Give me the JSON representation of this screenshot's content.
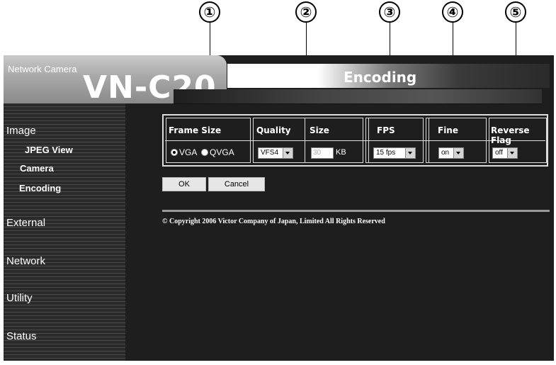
{
  "callouts": [
    "①",
    "②",
    "③",
    "④",
    "⑤"
  ],
  "header": {
    "product_line": "Network Camera",
    "model_prefix": "VN-",
    "model_suffix": "C20",
    "page_title": "Encoding"
  },
  "sidebar": {
    "sections": [
      {
        "label": "Image"
      },
      {
        "label": "External"
      },
      {
        "label": "Network"
      },
      {
        "label": "Utility"
      },
      {
        "label": "Status"
      }
    ],
    "image_items": [
      {
        "label": "JPEG View"
      },
      {
        "label": "Camera"
      },
      {
        "label": "Encoding"
      }
    ]
  },
  "settings": {
    "frame_size": {
      "header": "Frame Size",
      "options": [
        "VGA",
        "QVGA"
      ],
      "selected": "VGA"
    },
    "quality": {
      "header": "Quality",
      "value": "VFS4"
    },
    "size": {
      "header": "Size",
      "value": "30",
      "unit": "KB"
    },
    "fps": {
      "header": "FPS",
      "value": "15 fps"
    },
    "fine": {
      "header": "Fine",
      "value": "on"
    },
    "reverse_flag": {
      "header": "Reverse Flag",
      "value": "off"
    }
  },
  "buttons": {
    "ok": "OK",
    "cancel": "Cancel"
  },
  "footer": {
    "copyright": "© Copyright 2006 Victor Company of Japan, Limited All Rights Reserved"
  },
  "colors": {
    "background": "#1e1e1e",
    "text": "#ffffff",
    "sidebar_stripe": "#4a4a4a"
  }
}
